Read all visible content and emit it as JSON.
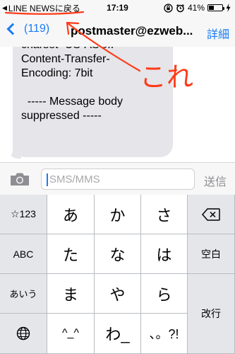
{
  "status_bar": {
    "back_app": "LINE NEWSに戻る",
    "time": "17:19",
    "battery_percent": "41%",
    "battery_level": 0.41
  },
  "nav": {
    "back_count": "(119)",
    "title": "postmaster@ezweb...",
    "detail": "詳細"
  },
  "message": {
    "lines": [
      "charset=US-ASCII",
      "Content-Transfer-",
      "Encoding: 7bit",
      "",
      "  ----- Message body",
      "suppressed -----"
    ]
  },
  "annotation": {
    "text": "これ",
    "color": "#ff3b1a"
  },
  "input": {
    "placeholder": "SMS/MMS",
    "send": "送信"
  },
  "keyboard": {
    "rows": [
      [
        "☆123",
        "あ",
        "か",
        "さ",
        "delete"
      ],
      [
        "ABC",
        "た",
        "な",
        "は",
        "空白"
      ],
      [
        "あいう",
        "ま",
        "や",
        "ら",
        "改行"
      ],
      [
        "globe",
        "^^",
        "わ_",
        "、。?!"
      ]
    ],
    "fn_left": [
      "☆123",
      "ABC",
      "あいう"
    ],
    "row1": [
      "あ",
      "か",
      "さ"
    ],
    "row2": [
      "た",
      "な",
      "は"
    ],
    "row3": [
      "ま",
      "や",
      "ら"
    ],
    "row4": [
      "^_^",
      "わ_",
      "、。?!"
    ],
    "space": "空白",
    "return": "改行"
  },
  "colors": {
    "accent": "#1a7cf5",
    "bubble": "#e5e5ea"
  }
}
